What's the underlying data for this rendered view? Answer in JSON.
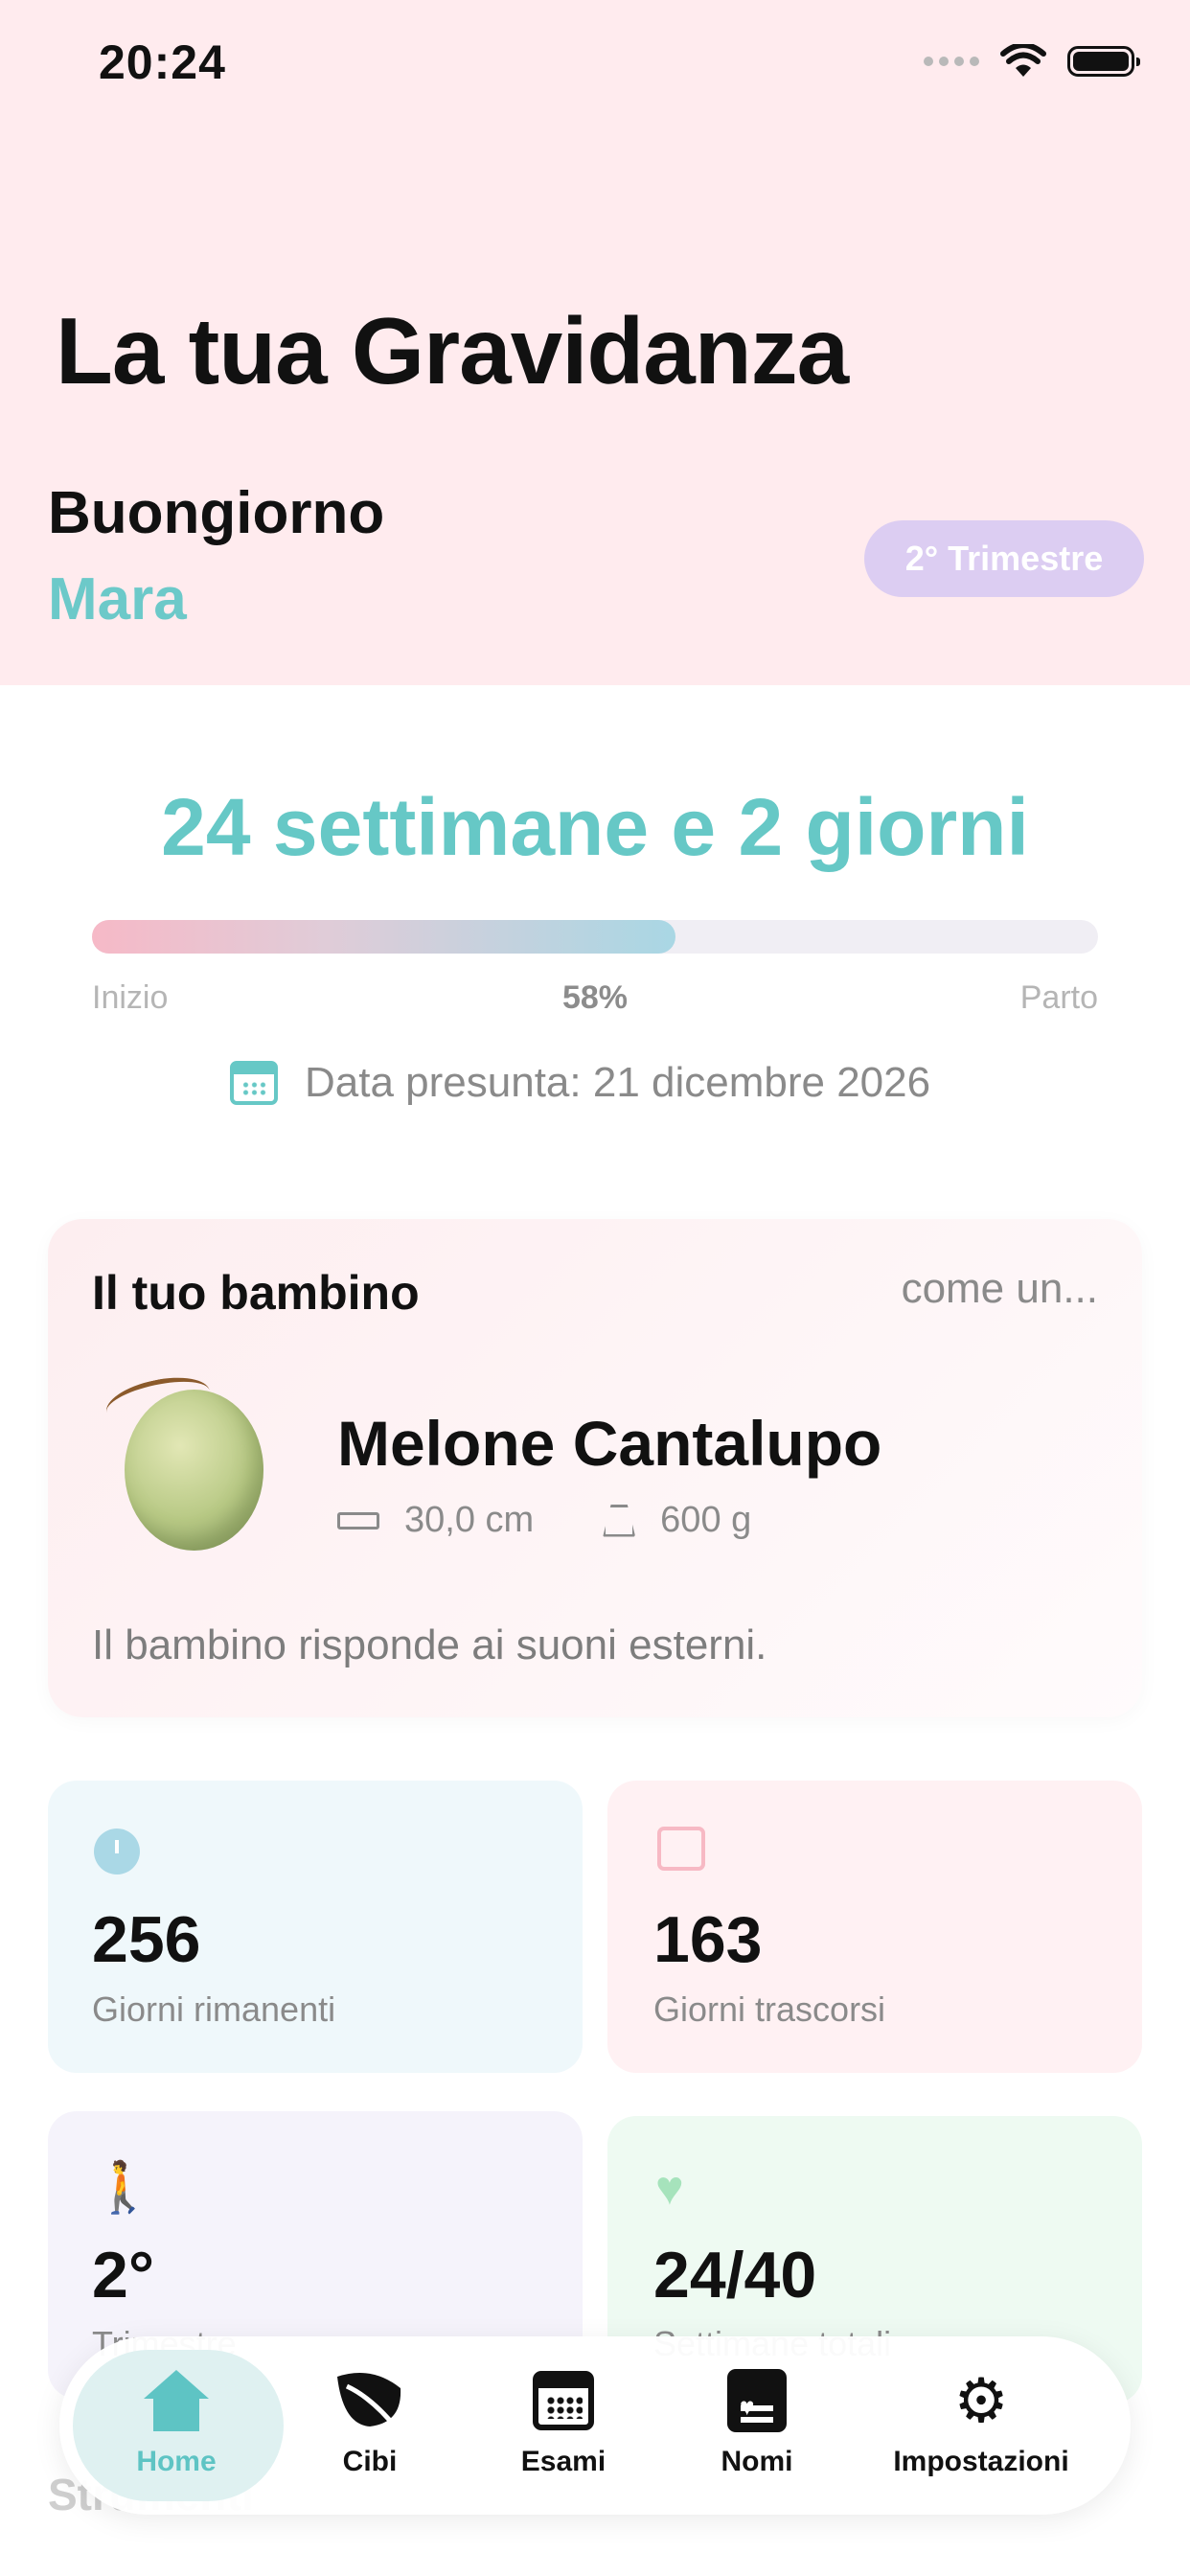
{
  "status_bar": {
    "time": "20:24"
  },
  "header": {
    "title": "La tua Gravidanza",
    "greeting": "Buongiorno",
    "name": "Mara",
    "trimester_badge": "2° Trimestre"
  },
  "progress": {
    "headline": "24 settimane e 2 giorni",
    "value_percent": 58,
    "percent_label": "58%",
    "start_label": "Inizio",
    "end_label": "Parto",
    "due_date": "Data presunta: 21 dicembre 2026"
  },
  "baby_card": {
    "title": "Il tuo bambino",
    "like_label": "come un...",
    "fruit": "Melone Cantalupo",
    "length": "30,0 cm",
    "weight": "600 g",
    "description": "Il bambino risponde ai suoni esterni."
  },
  "stats": [
    {
      "value": "256",
      "label": "Giorni rimanenti",
      "icon": "clock-icon"
    },
    {
      "value": "163",
      "label": "Giorni trascorsi",
      "icon": "calendar-check-icon"
    },
    {
      "value": "2°",
      "label": "Trimestre",
      "icon": "walking-icon"
    },
    {
      "value": "24/40",
      "label": "Settimane totali",
      "icon": "heart-icon"
    }
  ],
  "section_behind": "Strumenti",
  "tabs": [
    {
      "label": "Home",
      "icon": "home-icon",
      "selected": true
    },
    {
      "label": "Cibi",
      "icon": "leaf-icon"
    },
    {
      "label": "Esami",
      "icon": "calendar-icon"
    },
    {
      "label": "Nomi",
      "icon": "name-card-icon"
    },
    {
      "label": "Impostazioni",
      "icon": "gear-icon"
    }
  ],
  "colors": {
    "accent_teal": "#66c8c6",
    "header_pink": "#ffebee",
    "trimester_purple": "#dccdf2"
  }
}
